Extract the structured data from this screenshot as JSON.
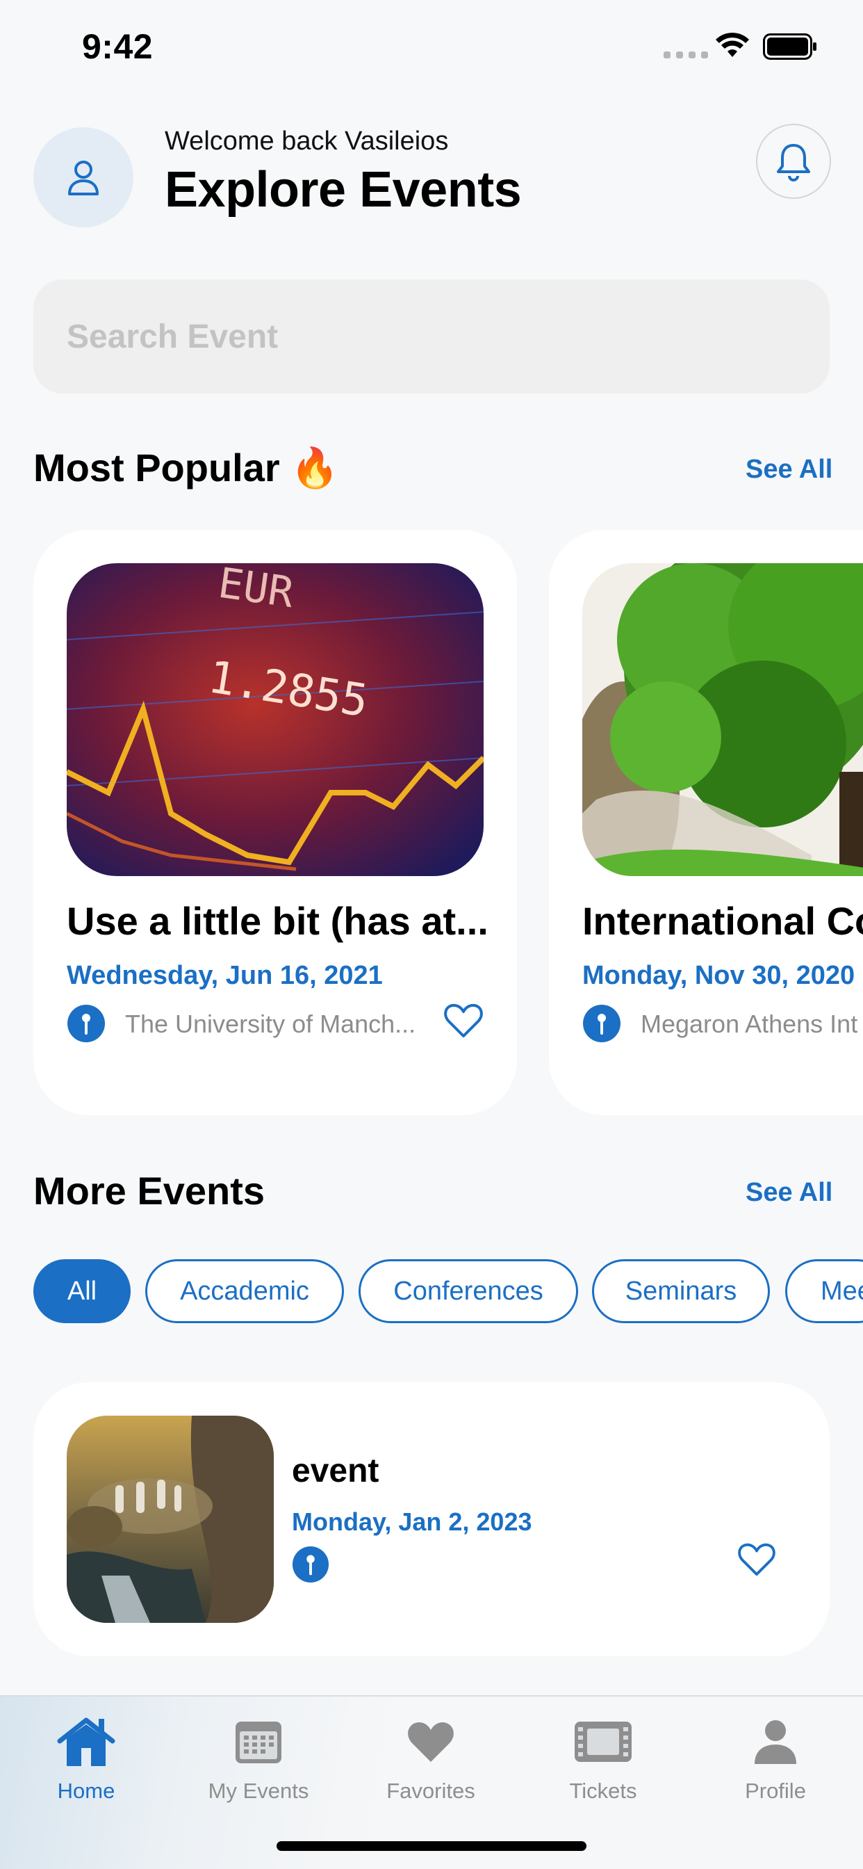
{
  "status_bar": {
    "time": "9:42"
  },
  "header": {
    "welcome": "Welcome back Vasileios",
    "title": "Explore Events",
    "avatar_icon": "user-icon",
    "bell_icon": "bell-icon"
  },
  "search": {
    "placeholder": "Search Event",
    "value": ""
  },
  "popular": {
    "title": "Most Popular 🔥",
    "see_all": "See All",
    "cards": [
      {
        "title": "Use a little bit (has at...",
        "date": "Wednesday, Jun 16, 2021",
        "location": "The University of Manch...",
        "image": "forex-chart-photo"
      },
      {
        "title": "International Co",
        "date": "Monday, Nov 30, 2020",
        "location": "Megaron Athens Int",
        "image": "tree-photo"
      }
    ]
  },
  "more_events": {
    "title": "More Events",
    "see_all": "See All",
    "chips": [
      "All",
      "Accademic",
      "Conferences",
      "Seminars",
      "Mee"
    ],
    "active_chip": "All",
    "events": [
      {
        "title": "event",
        "date": "Monday, Jan 2, 2023",
        "location": "",
        "image": "fantasy-landscape-photo"
      }
    ]
  },
  "tab_bar": {
    "active": "Home",
    "tabs": [
      {
        "label": "Home",
        "icon": "home-icon"
      },
      {
        "label": "My Events",
        "icon": "calendar-icon"
      },
      {
        "label": "Favorites",
        "icon": "heart-icon"
      },
      {
        "label": "Tickets",
        "icon": "ticket-icon"
      },
      {
        "label": "Profile",
        "icon": "person-icon"
      }
    ]
  },
  "colors": {
    "accent": "#1b6fc4",
    "background": "#f7f8f9",
    "card": "#ffffff"
  }
}
